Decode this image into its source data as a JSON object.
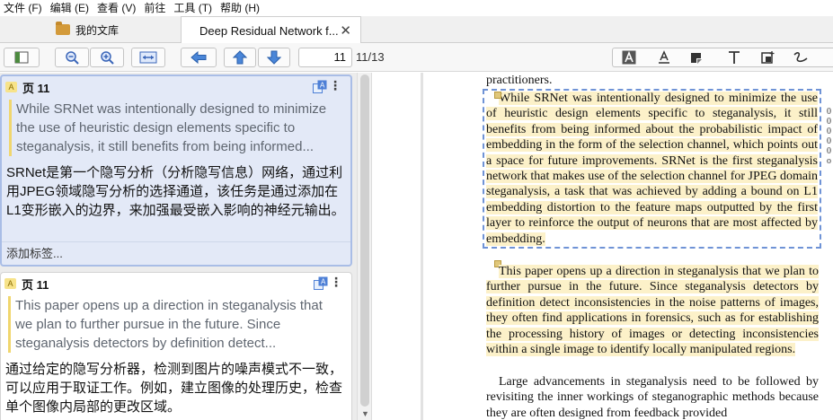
{
  "menu": [
    "文件 (F)",
    "编辑 (E)",
    "查看 (V)",
    "前往",
    "工具 (T)",
    "帮助 (H)"
  ],
  "tabs": {
    "library": "我的文库",
    "document": "Deep Residual Network f...",
    "close": "✕"
  },
  "toolbar": {
    "current_page": "11",
    "total_pages": "11/13",
    "icons": [
      "toggle-sidebar-icon",
      "zoom-out-icon",
      "zoom-in-icon",
      "fit-width-icon",
      "back-arrow-icon",
      "page-up-icon",
      "page-down-icon"
    ],
    "annotation_icons": [
      "select-text-icon",
      "underline-text-icon",
      "highlight-area-icon",
      "add-text-icon",
      "note-icon",
      "ink-icon"
    ]
  },
  "annotations": [
    {
      "type_badge": "A",
      "page_label": "页 11",
      "quote": "While SRNet was intentionally designed to minimize the use of heuristic design elements specific to steganalysis, it still benefits from being informed...",
      "comment": "SRNet是第一个隐写分析（分析隐写信息）网络，通过利用JPEG领域隐写分析的选择通道，该任务是通过添加在L1变形嵌入的边界，来加强最受嵌入影响的神经元输出。",
      "tag_prompt": "添加标签..."
    },
    {
      "type_badge": "A",
      "page_label": "页 11",
      "quote": "This paper opens up a direction in steganalysis that we plan to further pursue in the future. Since steganalysis detectors by definition detect...",
      "comment": "通过给定的隐写分析器，检测到图片的噪声模式不一致，可以应用于取证工作。例如，建立图像的处理历史，检查单个图像内局部的更改区域。"
    }
  ],
  "document": {
    "top_line": "practitioners.",
    "para1": "While SRNet was intentionally designed to minimize the use of heuristic design elements specific to steganalysis, it still benefits from being informed about the probabilistic impact of embedding in the form of the selection channel, which points out a space for future improvements. SRNet is the first steganalysis network that makes use of the selection channel for JPEG domain steganalysis, a task that was achieved by adding a bound on L1 embedding distortion to the feature maps outputted by the first layer to reinforce the output of neurons that are most affected by embedding.",
    "para2": "This paper opens up a direction in steganalysis that we plan to further pursue in the future. Since steganalysis detectors by definition detect inconsistencies in the noise patterns of images, they often find applications in forensics, such as for establishing the processing history of images or detecting inconsistencies within a single image to identify locally manipulated regions.",
    "para3": "Large advancements in steganalysis need to be followed by revisiting the inner workings of steganographic methods because they are often designed from feedback provided"
  },
  "colors": {
    "highlight": "#fcf1c9",
    "selection_border": "#6f93d6",
    "selected_card": "#e3e9f7"
  }
}
